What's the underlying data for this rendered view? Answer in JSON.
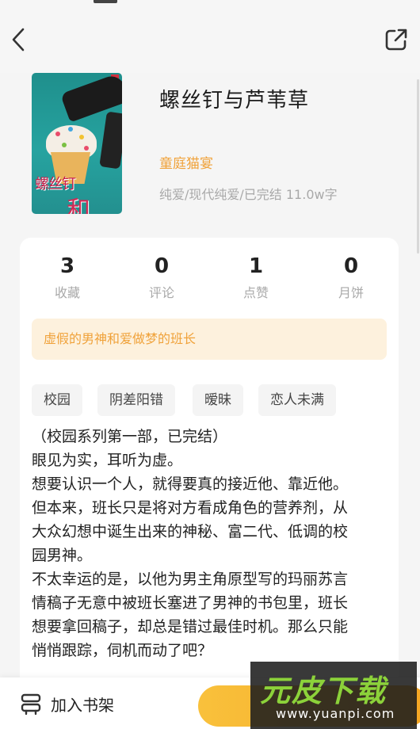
{
  "header": {
    "back_icon": "chevron-left-icon",
    "share_icon": "share-icon"
  },
  "book": {
    "title": "螺丝钉与芦苇草",
    "author": "童庭猫宴",
    "meta": "纯爱/现代纯爱/已完结 11.0w字",
    "cover_text_small": "螺丝钉",
    "cover_text_big": "和"
  },
  "stats": [
    {
      "value": "3",
      "label": "收藏"
    },
    {
      "value": "0",
      "label": "评论"
    },
    {
      "value": "1",
      "label": "点赞"
    },
    {
      "value": "0",
      "label": "月饼"
    }
  ],
  "intro": "虚假的男神和爱做梦的班长",
  "tags": [
    "校园",
    "阴差阳错",
    "暧昧",
    "恋人未满"
  ],
  "synopsis": [
    "（校园系列第一部，已完结）",
    "眼见为实，耳听为虚。",
    "想要认识一个人，就得要真的接近他、靠近他。",
    "但本来，班长只是将对方看成角色的营养剂，从",
    "大众幻想中诞生出来的神秘、富二代、低调的校",
    "园男神。",
    "不太幸运的是，以他为男主角原型写的玛丽苏言",
    "情稿子无意中被班长塞进了男神的书包里，班长",
    "想要拿回稿子，却总是错过最佳时机。那么只能",
    "悄悄跟踪，伺机而动了吧？"
  ],
  "bottom": {
    "shelf_label": "加入书架",
    "shelf_icon": "bookshelf-icon"
  },
  "watermark": {
    "title": "元皮下载",
    "url": "www.yuanpi.com"
  },
  "colors": {
    "accent": "#f0a23a",
    "banner_bg": "#fdf1dd",
    "page_bg": "#f5f5f5"
  }
}
